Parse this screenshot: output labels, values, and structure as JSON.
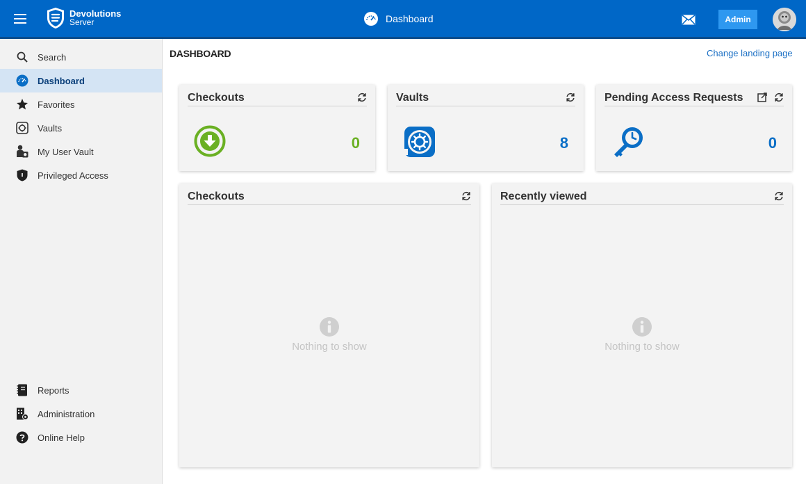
{
  "topbar": {
    "brand_line1": "Devolutions",
    "brand_line2": "Server",
    "title": "Dashboard",
    "admin_label": "Admin"
  },
  "sidebar": {
    "items": [
      {
        "label": "Search",
        "icon": "search-icon"
      },
      {
        "label": "Dashboard",
        "icon": "dashboard-icon",
        "active": true
      },
      {
        "label": "Favorites",
        "icon": "star-icon"
      },
      {
        "label": "Vaults",
        "icon": "vault-icon"
      },
      {
        "label": "My User Vault",
        "icon": "user-vault-icon"
      },
      {
        "label": "Privileged Access",
        "icon": "shield-icon"
      }
    ],
    "bottom_items": [
      {
        "label": "Reports",
        "icon": "reports-icon"
      },
      {
        "label": "Administration",
        "icon": "administration-icon"
      },
      {
        "label": "Online Help",
        "icon": "help-icon"
      }
    ]
  },
  "main": {
    "title": "DASHBOARD",
    "change_landing_label": "Change landing page"
  },
  "widgets": {
    "checkouts": {
      "title": "Checkouts",
      "value": "0",
      "color": "#6ab023"
    },
    "vaults": {
      "title": "Vaults",
      "value": "8",
      "color": "#0a6ec6"
    },
    "pending": {
      "title": "Pending Access Requests",
      "value": "0",
      "color": "#0a6ec6"
    }
  },
  "panels": {
    "checkouts": {
      "title": "Checkouts",
      "empty_text": "Nothing to show"
    },
    "recent": {
      "title": "Recently viewed",
      "empty_text": "Nothing to show"
    }
  },
  "colors": {
    "topbar": "#0067c7",
    "accent": "#2e98f0",
    "link": "#1a6fc4"
  }
}
